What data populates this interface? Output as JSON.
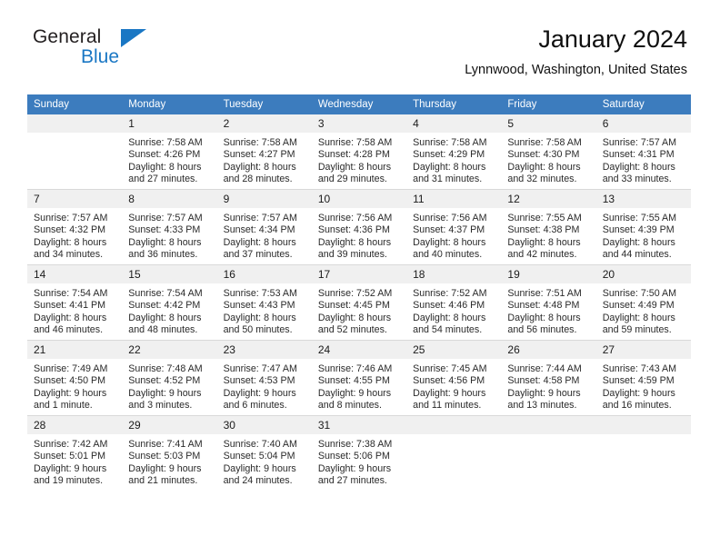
{
  "brand": {
    "word_general": "General",
    "word_blue": "Blue"
  },
  "header": {
    "month_title": "January 2024",
    "location": "Lynnwood, Washington, United States"
  },
  "calendar": {
    "weekday_headers": [
      "Sunday",
      "Monday",
      "Tuesday",
      "Wednesday",
      "Thursday",
      "Friday",
      "Saturday"
    ],
    "colors": {
      "header_background": "#3c7cbe",
      "header_text": "#ffffff",
      "daynum_background": "#f0f0f0",
      "cell_background": "#ffffff",
      "row_divider": "#d9d9d9",
      "brand_blue": "#1a77c4"
    },
    "weeks": [
      [
        {
          "day": "",
          "blank": true
        },
        {
          "day": "1",
          "sunrise": "Sunrise: 7:58 AM",
          "sunset": "Sunset: 4:26 PM",
          "daylight_1": "Daylight: 8 hours",
          "daylight_2": "and 27 minutes."
        },
        {
          "day": "2",
          "sunrise": "Sunrise: 7:58 AM",
          "sunset": "Sunset: 4:27 PM",
          "daylight_1": "Daylight: 8 hours",
          "daylight_2": "and 28 minutes."
        },
        {
          "day": "3",
          "sunrise": "Sunrise: 7:58 AM",
          "sunset": "Sunset: 4:28 PM",
          "daylight_1": "Daylight: 8 hours",
          "daylight_2": "and 29 minutes."
        },
        {
          "day": "4",
          "sunrise": "Sunrise: 7:58 AM",
          "sunset": "Sunset: 4:29 PM",
          "daylight_1": "Daylight: 8 hours",
          "daylight_2": "and 31 minutes."
        },
        {
          "day": "5",
          "sunrise": "Sunrise: 7:58 AM",
          "sunset": "Sunset: 4:30 PM",
          "daylight_1": "Daylight: 8 hours",
          "daylight_2": "and 32 minutes."
        },
        {
          "day": "6",
          "sunrise": "Sunrise: 7:57 AM",
          "sunset": "Sunset: 4:31 PM",
          "daylight_1": "Daylight: 8 hours",
          "daylight_2": "and 33 minutes."
        }
      ],
      [
        {
          "day": "7",
          "sunrise": "Sunrise: 7:57 AM",
          "sunset": "Sunset: 4:32 PM",
          "daylight_1": "Daylight: 8 hours",
          "daylight_2": "and 34 minutes."
        },
        {
          "day": "8",
          "sunrise": "Sunrise: 7:57 AM",
          "sunset": "Sunset: 4:33 PM",
          "daylight_1": "Daylight: 8 hours",
          "daylight_2": "and 36 minutes."
        },
        {
          "day": "9",
          "sunrise": "Sunrise: 7:57 AM",
          "sunset": "Sunset: 4:34 PM",
          "daylight_1": "Daylight: 8 hours",
          "daylight_2": "and 37 minutes."
        },
        {
          "day": "10",
          "sunrise": "Sunrise: 7:56 AM",
          "sunset": "Sunset: 4:36 PM",
          "daylight_1": "Daylight: 8 hours",
          "daylight_2": "and 39 minutes."
        },
        {
          "day": "11",
          "sunrise": "Sunrise: 7:56 AM",
          "sunset": "Sunset: 4:37 PM",
          "daylight_1": "Daylight: 8 hours",
          "daylight_2": "and 40 minutes."
        },
        {
          "day": "12",
          "sunrise": "Sunrise: 7:55 AM",
          "sunset": "Sunset: 4:38 PM",
          "daylight_1": "Daylight: 8 hours",
          "daylight_2": "and 42 minutes."
        },
        {
          "day": "13",
          "sunrise": "Sunrise: 7:55 AM",
          "sunset": "Sunset: 4:39 PM",
          "daylight_1": "Daylight: 8 hours",
          "daylight_2": "and 44 minutes."
        }
      ],
      [
        {
          "day": "14",
          "sunrise": "Sunrise: 7:54 AM",
          "sunset": "Sunset: 4:41 PM",
          "daylight_1": "Daylight: 8 hours",
          "daylight_2": "and 46 minutes."
        },
        {
          "day": "15",
          "sunrise": "Sunrise: 7:54 AM",
          "sunset": "Sunset: 4:42 PM",
          "daylight_1": "Daylight: 8 hours",
          "daylight_2": "and 48 minutes."
        },
        {
          "day": "16",
          "sunrise": "Sunrise: 7:53 AM",
          "sunset": "Sunset: 4:43 PM",
          "daylight_1": "Daylight: 8 hours",
          "daylight_2": "and 50 minutes."
        },
        {
          "day": "17",
          "sunrise": "Sunrise: 7:52 AM",
          "sunset": "Sunset: 4:45 PM",
          "daylight_1": "Daylight: 8 hours",
          "daylight_2": "and 52 minutes."
        },
        {
          "day": "18",
          "sunrise": "Sunrise: 7:52 AM",
          "sunset": "Sunset: 4:46 PM",
          "daylight_1": "Daylight: 8 hours",
          "daylight_2": "and 54 minutes."
        },
        {
          "day": "19",
          "sunrise": "Sunrise: 7:51 AM",
          "sunset": "Sunset: 4:48 PM",
          "daylight_1": "Daylight: 8 hours",
          "daylight_2": "and 56 minutes."
        },
        {
          "day": "20",
          "sunrise": "Sunrise: 7:50 AM",
          "sunset": "Sunset: 4:49 PM",
          "daylight_1": "Daylight: 8 hours",
          "daylight_2": "and 59 minutes."
        }
      ],
      [
        {
          "day": "21",
          "sunrise": "Sunrise: 7:49 AM",
          "sunset": "Sunset: 4:50 PM",
          "daylight_1": "Daylight: 9 hours",
          "daylight_2": "and 1 minute."
        },
        {
          "day": "22",
          "sunrise": "Sunrise: 7:48 AM",
          "sunset": "Sunset: 4:52 PM",
          "daylight_1": "Daylight: 9 hours",
          "daylight_2": "and 3 minutes."
        },
        {
          "day": "23",
          "sunrise": "Sunrise: 7:47 AM",
          "sunset": "Sunset: 4:53 PM",
          "daylight_1": "Daylight: 9 hours",
          "daylight_2": "and 6 minutes."
        },
        {
          "day": "24",
          "sunrise": "Sunrise: 7:46 AM",
          "sunset": "Sunset: 4:55 PM",
          "daylight_1": "Daylight: 9 hours",
          "daylight_2": "and 8 minutes."
        },
        {
          "day": "25",
          "sunrise": "Sunrise: 7:45 AM",
          "sunset": "Sunset: 4:56 PM",
          "daylight_1": "Daylight: 9 hours",
          "daylight_2": "and 11 minutes."
        },
        {
          "day": "26",
          "sunrise": "Sunrise: 7:44 AM",
          "sunset": "Sunset: 4:58 PM",
          "daylight_1": "Daylight: 9 hours",
          "daylight_2": "and 13 minutes."
        },
        {
          "day": "27",
          "sunrise": "Sunrise: 7:43 AM",
          "sunset": "Sunset: 4:59 PM",
          "daylight_1": "Daylight: 9 hours",
          "daylight_2": "and 16 minutes."
        }
      ],
      [
        {
          "day": "28",
          "sunrise": "Sunrise: 7:42 AM",
          "sunset": "Sunset: 5:01 PM",
          "daylight_1": "Daylight: 9 hours",
          "daylight_2": "and 19 minutes."
        },
        {
          "day": "29",
          "sunrise": "Sunrise: 7:41 AM",
          "sunset": "Sunset: 5:03 PM",
          "daylight_1": "Daylight: 9 hours",
          "daylight_2": "and 21 minutes."
        },
        {
          "day": "30",
          "sunrise": "Sunrise: 7:40 AM",
          "sunset": "Sunset: 5:04 PM",
          "daylight_1": "Daylight: 9 hours",
          "daylight_2": "and 24 minutes."
        },
        {
          "day": "31",
          "sunrise": "Sunrise: 7:38 AM",
          "sunset": "Sunset: 5:06 PM",
          "daylight_1": "Daylight: 9 hours",
          "daylight_2": "and 27 minutes."
        },
        {
          "day": "",
          "blank": true
        },
        {
          "day": "",
          "blank": true
        },
        {
          "day": "",
          "blank": true
        }
      ]
    ]
  }
}
